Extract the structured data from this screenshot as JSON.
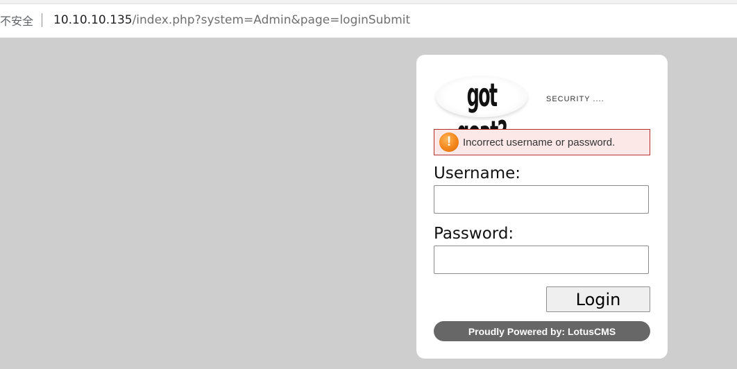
{
  "browser": {
    "security_label": "不安全",
    "url_host": "10.10.10.135",
    "url_path": "/index.php?system=Admin&page=loginSubmit"
  },
  "login": {
    "logo_text": "got goat?",
    "tagline": "SECURITY ....",
    "error_message": "Incorrect username or password.",
    "warning_icon_glyph": "!",
    "username_label": "Username:",
    "username_value": "",
    "password_label": "Password:",
    "password_value": "",
    "login_button_label": "Login",
    "footer_text": "Proudly Powered by: LotusCMS"
  },
  "colors": {
    "page_background": "#cecece",
    "error_background": "#fde8e8",
    "error_border": "#b33030",
    "warning_icon": "#f3861a",
    "footer_background": "#676767"
  },
  "icons": {
    "warning": "warning-icon"
  }
}
